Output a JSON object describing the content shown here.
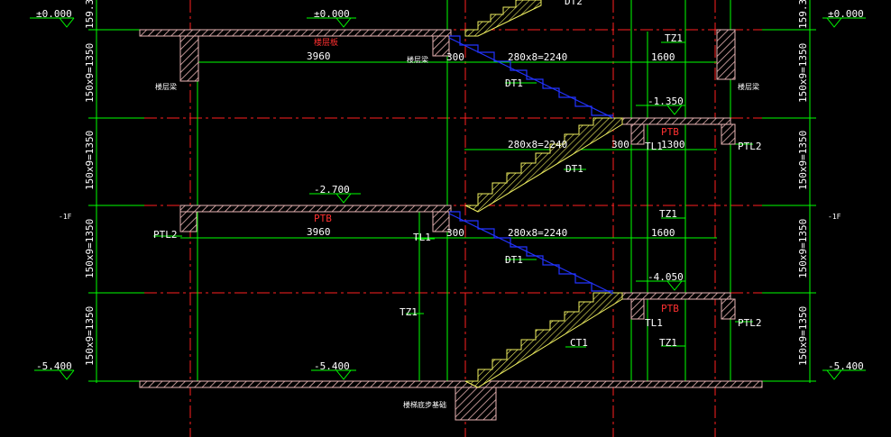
{
  "colors": {
    "background": "#000000",
    "grid_red": "#ff2020",
    "dim_green": "#00ff00",
    "text_white": "#ffffff",
    "hatch_yellow": "#f0f060",
    "slab_fill": "#e8b3b3",
    "stair_blue": "#2233ff",
    "label_red": "#ff3030"
  },
  "elevations": {
    "top_left": "±0.000",
    "top_mid": "±0.000",
    "top_right": "±0.000",
    "e_1350": "-1.350",
    "e_2700": "-2.700",
    "e_4050": "-4.050",
    "bottom_left": "-5.400",
    "bottom_mid": "-5.400",
    "bottom_right": "-5.400"
  },
  "dimensions": {
    "left_top": "159.3",
    "right_top": "159.3",
    "flight_1": "150x9=1350",
    "flight_2": "150x9=1350",
    "flight_3": "150x9=1350",
    "flight_4": "150x9=1350",
    "landing_3960_a": "3960",
    "landing_3960_b": "3960",
    "tread_300_a": "300",
    "tread_300_b": "300",
    "tread_300_c": "300",
    "run_2240_a": "280x8=2240",
    "run_2240_b": "280x8=2240",
    "run_2240_c": "280x8=2240",
    "width_1600_a": "1600",
    "width_1600_b": "1600",
    "width_1300": "1300"
  },
  "labels": {
    "dt2": "DT2",
    "dt1_a": "DT1",
    "dt1_b": "DT1",
    "dt1_c": "DT1",
    "ct1": "CT1",
    "tz1_a": "TZ1",
    "tz1_b": "TZ1",
    "tz1_c": "TZ1",
    "tz1_d": "TZ1",
    "tl1_a": "TL1",
    "tl1_b": "TL1",
    "tl1_c": "TL1",
    "ptl2_a": "PTL2",
    "ptl2_b": "PTL2",
    "ptl2_c": "PTL2",
    "ptb_a": "PTB",
    "ptb_b": "PTB",
    "ptb_c": "PTB",
    "floor_beam_a": "楼层梁",
    "floor_beam_b": "楼层梁",
    "floor_beam_c": "楼层梁",
    "floor_slab": "楼层板",
    "foundation": "楼梯底步基础",
    "side_left": "-1F",
    "side_right": "-1F"
  }
}
